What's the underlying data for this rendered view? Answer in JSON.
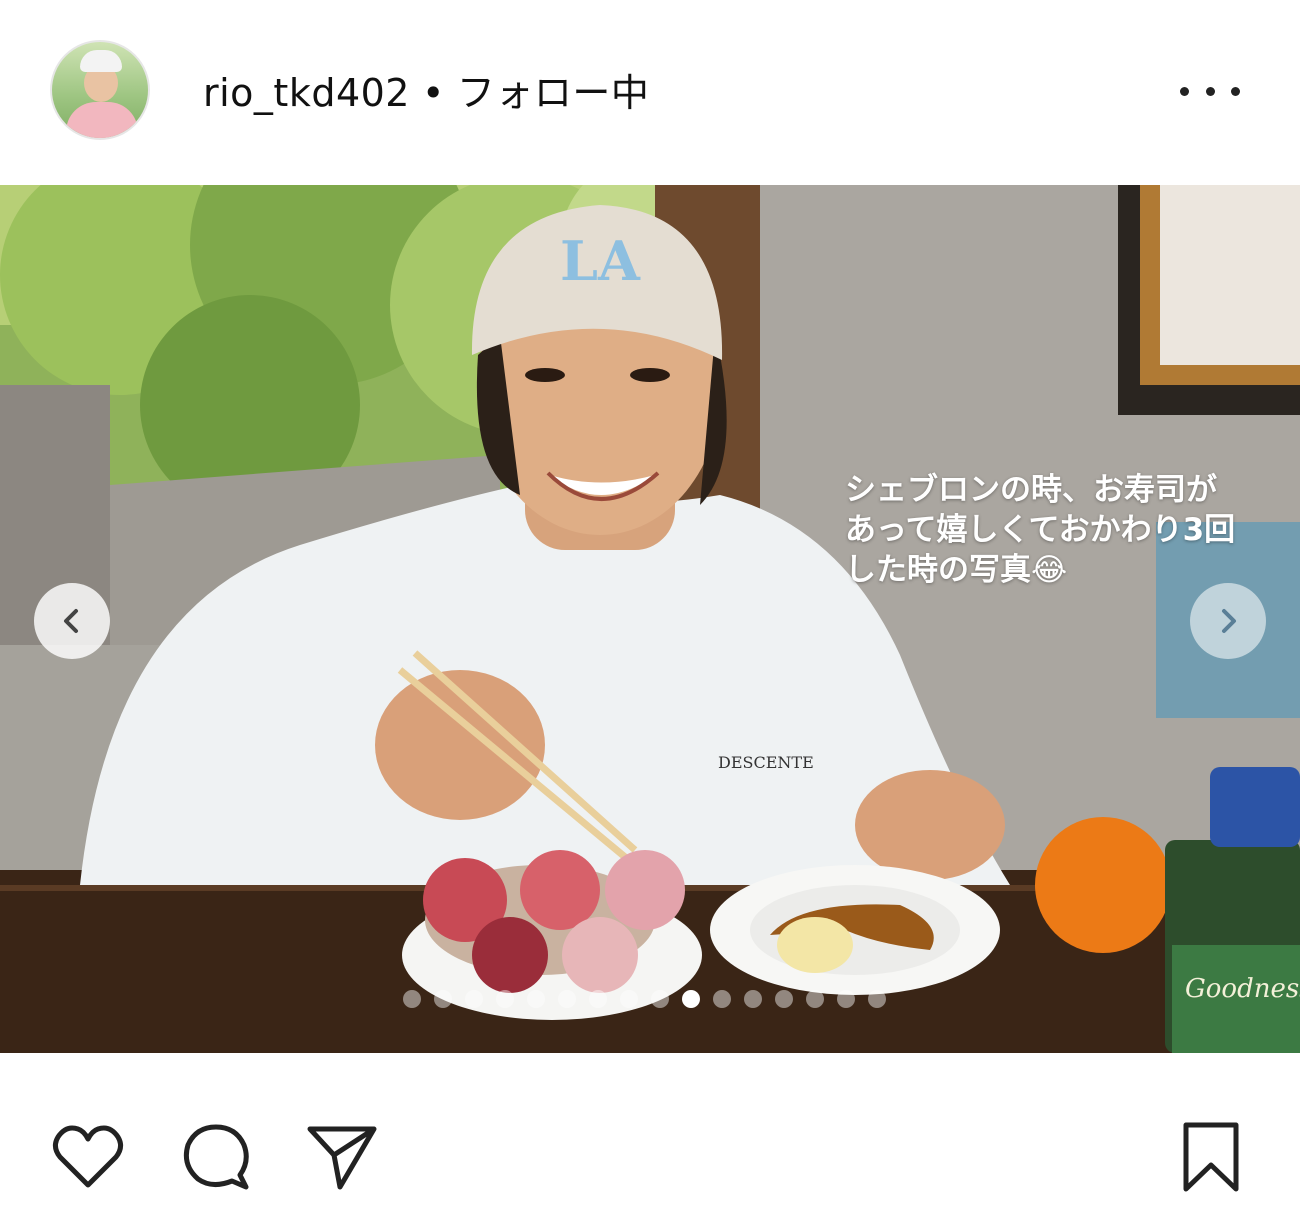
{
  "post": {
    "username": "rio_tkd402",
    "separator": "•",
    "follow_status": "フォロー中"
  },
  "photo": {
    "caption": "シェブロンの時、お寿司が\nあって嬉しくておかわり3回\nした時の写真😂",
    "cap_logo": "LA",
    "shirt_brand": "DESCENTE",
    "bottle_text": "Goodness",
    "carousel": {
      "total": 16,
      "active_index": 9
    }
  },
  "icons": {
    "more": "more-options-icon",
    "prev": "chevron-left-icon",
    "next": "chevron-right-icon",
    "like": "heart-icon",
    "comment": "comment-icon",
    "share": "share-icon",
    "save": "bookmark-icon"
  },
  "colors": {
    "text": "#111111",
    "caption": "#ffffff"
  }
}
